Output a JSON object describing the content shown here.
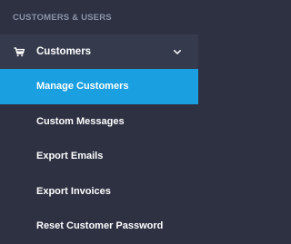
{
  "sidebar": {
    "section_title": "CUSTOMERS & USERS",
    "group": {
      "label": "Customers",
      "icon": "shopping-cart-icon",
      "expanded": true,
      "chevron_icon": "chevron-down-icon"
    },
    "items": [
      {
        "label": "Manage Customers",
        "active": true
      },
      {
        "label": "Custom Messages",
        "active": false
      },
      {
        "label": "Export Emails",
        "active": false
      },
      {
        "label": "Export Invoices",
        "active": false
      },
      {
        "label": "Reset Customer Password",
        "active": false
      }
    ]
  },
  "colors": {
    "background": "#2d3142",
    "group_background": "#353a4d",
    "active_background": "#1a9fe0",
    "section_text": "#8d93a8",
    "item_text": "#ffffff"
  }
}
